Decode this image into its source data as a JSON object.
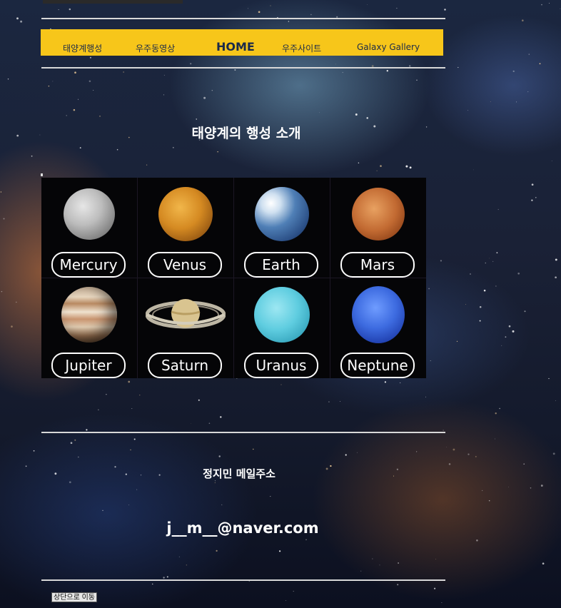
{
  "nav": {
    "items": [
      "태양계행성",
      "우주동영상",
      "HOME",
      "우주사이트",
      "Galaxy Gallery"
    ]
  },
  "main": {
    "title": "태양계의 행성 소개",
    "planets": [
      "Mercury",
      "Venus",
      "Earth",
      "Mars",
      "Jupiter",
      "Saturn",
      "Uranus",
      "Neptune"
    ]
  },
  "footer": {
    "name": "정지민 메일주소",
    "email": "j__m__@naver.com",
    "top_button": "상단으로 이동"
  },
  "colors": {
    "nav_background": "#f7c61a",
    "nav_text": "#1b2a4a",
    "text": "#ffffff"
  }
}
